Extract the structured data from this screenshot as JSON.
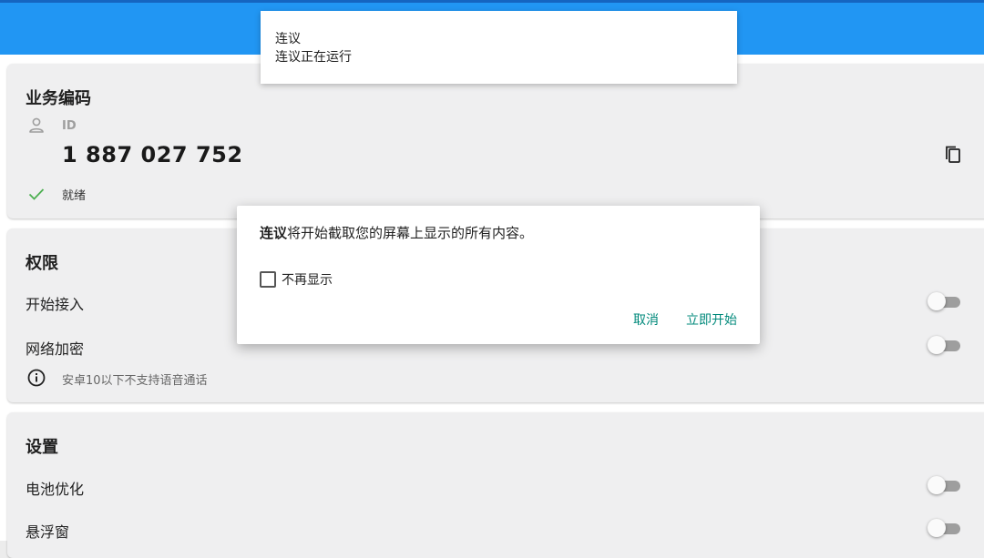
{
  "notification": {
    "title": "连议",
    "text": "连议正在运行"
  },
  "card_business": {
    "title": "业务编码",
    "id_label": "ID",
    "id_value": "1 887 027 752",
    "status": "就绪"
  },
  "card_permissions": {
    "title": "权限",
    "items": [
      {
        "label": "开始接入",
        "enabled": false
      },
      {
        "label": "网络加密",
        "enabled": false
      }
    ],
    "info": "安卓10以下不支持语音通话"
  },
  "card_settings": {
    "title": "设置",
    "items": [
      {
        "label": "电池优化",
        "enabled": false
      },
      {
        "label": "悬浮窗",
        "enabled": false
      }
    ]
  },
  "dialog": {
    "app_name": "连议",
    "message": "将开始截取您的屏幕上显示的所有内容。",
    "checkbox_label": "不再显示",
    "cancel": "取消",
    "confirm": "立即开始"
  },
  "colors": {
    "appbar": "#2196f3",
    "accent": "#00897b",
    "status_ok": "#4caf50"
  }
}
